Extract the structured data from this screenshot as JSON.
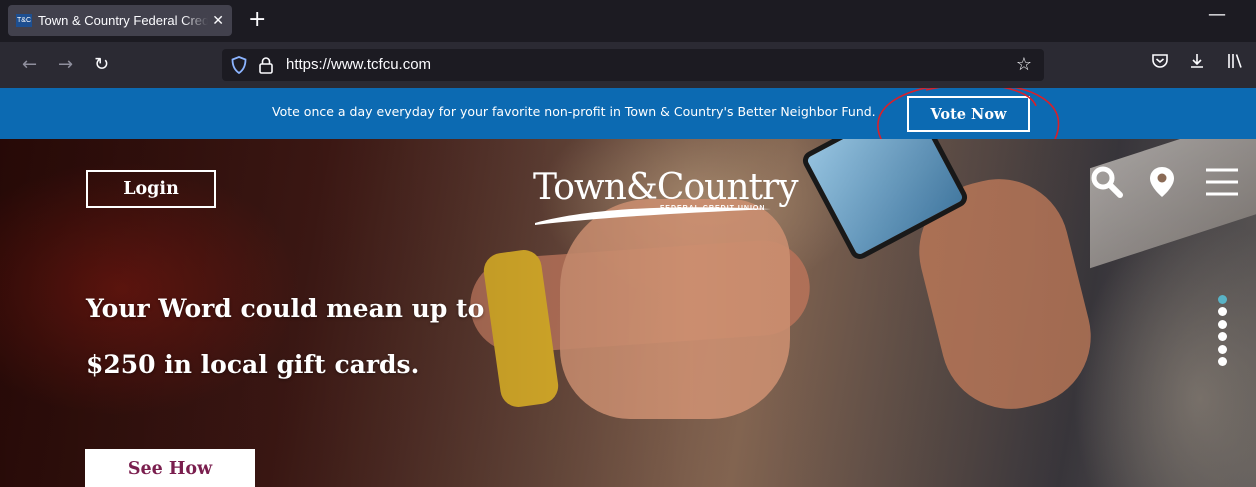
{
  "browser": {
    "tab_title": "Town & Country Federal Credit Union",
    "favicon_text": "T&C",
    "tab_close": "✕",
    "new_tab": "+",
    "minimize": "—",
    "url": "https://www.tcfcu.com",
    "nav_icons": [
      "back-arrow-icon",
      "forward-arrow-icon",
      "reload-icon"
    ],
    "toolbar_icons": [
      "pocket-icon",
      "download-icon",
      "library-icon"
    ]
  },
  "banner": {
    "message": "Vote once a day everyday for your favorite non-profit in Town & Country's Better Neighbor Fund.",
    "vote_label": "Vote Now",
    "annotation_color": "#d9202a"
  },
  "header": {
    "login_label": "Login",
    "logo_text": "Town&Country",
    "logo_subtext": "FEDERAL CREDIT UNION",
    "icons": [
      "search-icon",
      "location-pin-icon",
      "menu-icon"
    ]
  },
  "hero": {
    "headline_line1": "Your Word could mean up to",
    "headline_line2": "$250 in local gift cards.",
    "cta_label": "See How",
    "slide_count": 6,
    "active_slide": 1
  },
  "colors": {
    "banner_bg": "#0c6ab2",
    "cta_text": "#7a1e4e",
    "active_dot": "#59b3c6"
  }
}
